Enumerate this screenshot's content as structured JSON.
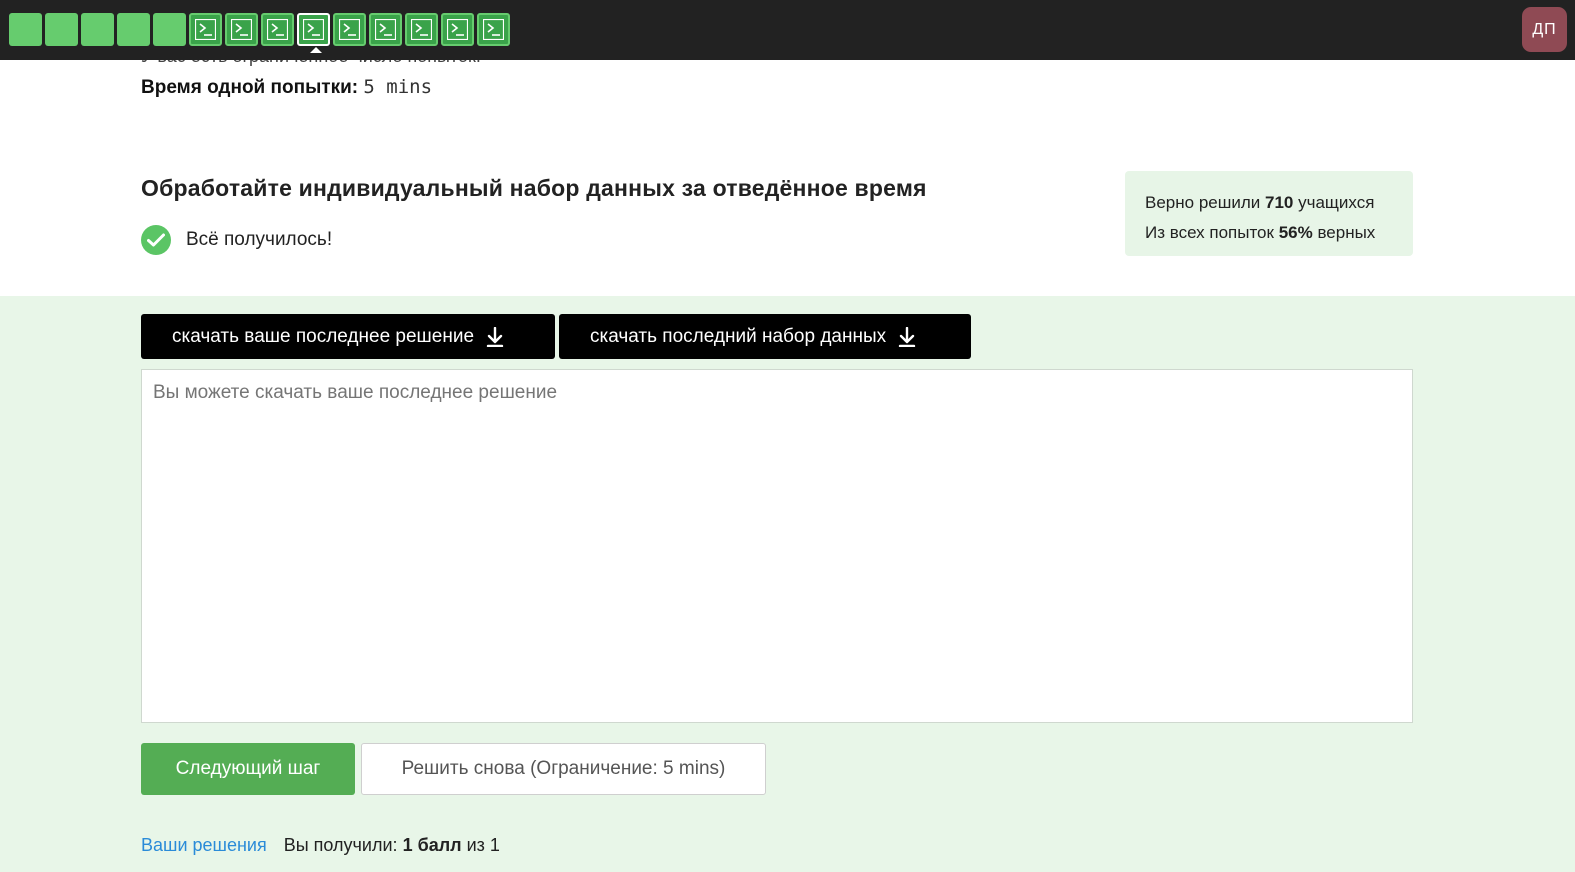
{
  "steps": [
    {
      "type": "done"
    },
    {
      "type": "done"
    },
    {
      "type": "done"
    },
    {
      "type": "done"
    },
    {
      "type": "done"
    },
    {
      "type": "code"
    },
    {
      "type": "code"
    },
    {
      "type": "code"
    },
    {
      "type": "code",
      "current": true
    },
    {
      "type": "code"
    },
    {
      "type": "code"
    },
    {
      "type": "code"
    },
    {
      "type": "code"
    },
    {
      "type": "code"
    }
  ],
  "user": {
    "initials": "ДП"
  },
  "attempt": {
    "hidden_line": "У вас есть ограниченное число попыток.",
    "time_label": "Время одной попытки:",
    "time_value": "5 mins"
  },
  "task": {
    "title": "Обработайте индивидуальный набор данных за отведённое время",
    "status": "Всё получилось!"
  },
  "stats": {
    "solved_prefix": "Верно решили",
    "solved_count": "710",
    "solved_suffix": "учащихся",
    "attempts_prefix": "Из всех попыток",
    "attempts_percent": "56%",
    "attempts_suffix": "верных"
  },
  "buttons": {
    "download_solution": "скачать ваше последнее решение",
    "download_dataset": "скачать последний набор данных",
    "next_step": "Следующий шаг",
    "retry": "Решить снова (Ограничение: 5 mins)"
  },
  "answer": {
    "placeholder": "Вы можете скачать ваше последнее решение",
    "value": ""
  },
  "footer": {
    "solutions_link": "Ваши решения",
    "score_prefix": "Вы получили:",
    "score_value": "1 балл",
    "score_suffix": "из 1"
  },
  "colors": {
    "topbar": "#222222",
    "step_done": "#66cc6e",
    "accent_green": "#54ad54",
    "section_bg": "#e8f6e8",
    "link": "#2a8bd8",
    "avatar": "#8f4a54"
  }
}
